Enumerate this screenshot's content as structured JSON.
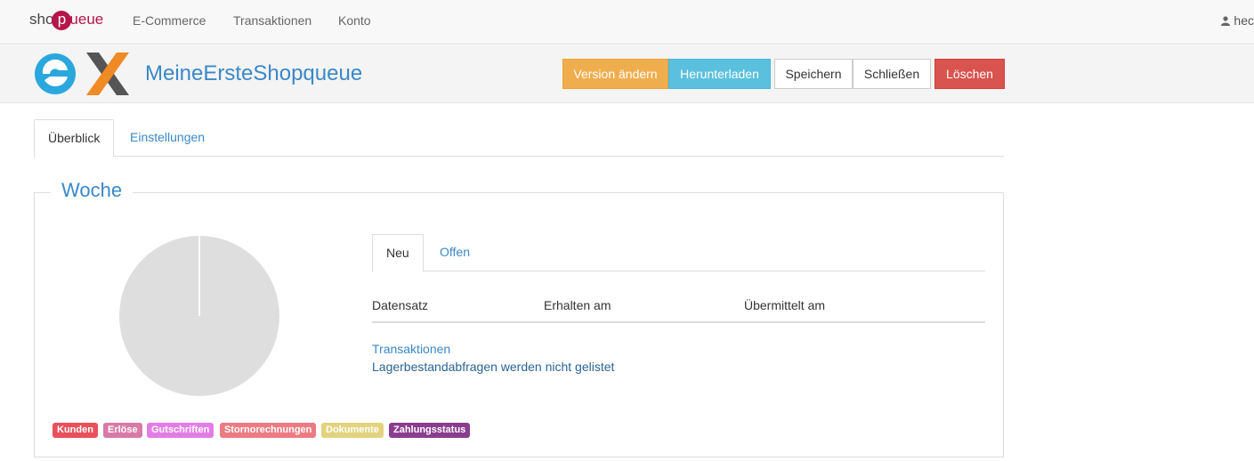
{
  "navbar": {
    "brand_shop": "sho",
    "brand_p": "p",
    "brand_queue": "ueue",
    "links": [
      "E-Commerce",
      "Transaktionen",
      "Konto"
    ],
    "user": "hec"
  },
  "header": {
    "title": "MeineErsteShopqueue",
    "buttons": {
      "version": "Version ändern",
      "download": "Herunterladen",
      "save": "Speichern",
      "close": "Schließen",
      "delete": "Löschen"
    }
  },
  "tabs": [
    "Überblick",
    "Einstellungen"
  ],
  "panel": {
    "legend": "Woche",
    "inner_tabs": [
      "Neu",
      "Offen"
    ],
    "table_headers": [
      "Datensatz",
      "Erhalten am",
      "Übermittelt am"
    ],
    "rows": [
      {
        "text": "Transaktionen",
        "type": "link"
      },
      {
        "text": "Lagerbestandabfragen werden nicht gelistet",
        "type": "text"
      }
    ],
    "badges": [
      {
        "label": "Kunden",
        "color": "#e8505b"
      },
      {
        "label": "Erlöse",
        "color": "#d87aa8"
      },
      {
        "label": "Gutschriften",
        "color": "#e47ce6"
      },
      {
        "label": "Stornorechnungen",
        "color": "#ec7b82"
      },
      {
        "label": "Dokumente",
        "color": "#e3d27e"
      },
      {
        "label": "Zahlungsstatus",
        "color": "#8a3d8e"
      }
    ]
  },
  "colors": {
    "accent": "#3a88c8",
    "brand": "#b5164a",
    "pie_empty": "#dedede"
  }
}
